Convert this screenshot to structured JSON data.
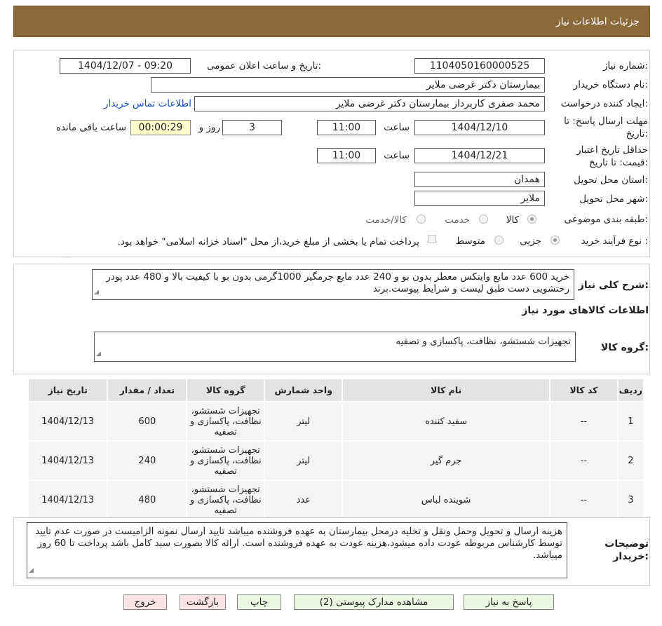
{
  "header": {
    "title": "جزئیات اطلاعات نیاز"
  },
  "watermark": {
    "text": "AriaTender.neT"
  },
  "form": {
    "need_number_label": "شماره نیاز:",
    "need_number": "1104050160000525",
    "announce_label": "تاریخ و ساعت اعلان عمومی:",
    "announce_value": "1404/12/07 - 09:20",
    "buyer_org_label": "نام دستگاه خریدار:",
    "buyer_org": "بیمارستان دکتر غرضی ملایر",
    "creator_label": "ایجاد کننده درخواست:",
    "creator": "محمد صفری کارپرداز بیمارستان دکتر غرضی ملایر",
    "contact_link": "اطلاعات تماس خریدار",
    "deadline_label_1": "مهلت ارسال پاسخ: تا",
    "deadline_label_2": "تاریخ:",
    "deadline_date": "1404/12/10",
    "time_label": "ساعت",
    "deadline_time": "11:00",
    "days_value": "3",
    "days_label": "روز و",
    "timer_value": "00:00:29",
    "remaining_label": "ساعت باقی مانده",
    "validity_label_1": "حداقل تاریخ اعتبار",
    "validity_label_2": "قیمت: تا تاریخ:",
    "validity_date": "1404/12/21",
    "validity_time": "11:00",
    "province_label": "استان محل تحویل:",
    "province": "همدان",
    "city_label": "شهر محل تحویل:",
    "city": "ملایر",
    "category_label": "طبقه بندی موضوعی:",
    "category_options": [
      "کالا",
      "خدمت",
      "کالا/خدمت"
    ],
    "process_label": "نوع فرآیند خرید :",
    "process_options": [
      "جزیی",
      "متوسط"
    ],
    "payment_note": "پرداخت تمام یا بخشی از مبلغ خرید،از محل \"اسناد خزانه اسلامی\" خواهد بود."
  },
  "summary": {
    "label": "شرح کلی نیاز:",
    "text": "خرید 600  عدد مایع وایتکس معطر بدون بو و 240 عدد مایع جرمگیر 1000گرمی بدون بو با کیفیت بالا و 480 عدد پودر  رختشویی دست طبق لیست و شرایط پیوست.برند",
    "goods_info_title": "اطلاعات کالاهای مورد نیاز",
    "group_label": "گروه کالا:",
    "group_value": "تجهیزات شستشو، نظافت، پاکسازی و تصفیه"
  },
  "table": {
    "headers": [
      "ردیف",
      "کد کالا",
      "نام کالا",
      "واحد شمارش",
      "گروه کالا",
      "تعداد / مقدار",
      "تاریخ نیاز"
    ],
    "rows": [
      {
        "row": "1",
        "code": "--",
        "name": "سفید کننده",
        "unit": "لیتر",
        "group": "تجهیزات شستشو، نظافت، پاکسازی و تصفیه",
        "qty": "600",
        "date": "1404/12/13"
      },
      {
        "row": "2",
        "code": "--",
        "name": "جرم گیر",
        "unit": "لیتر",
        "group": "تجهیزات شستشو، نظافت، پاکسازی و تصفیه",
        "qty": "240",
        "date": "1404/12/13"
      },
      {
        "row": "3",
        "code": "--",
        "name": "شوینده لباس",
        "unit": "عدد",
        "group": "تجهیزات شستشو، نظافت، پاکسازی و تصفیه",
        "qty": "480",
        "date": "1404/12/13"
      }
    ]
  },
  "notes": {
    "label_1": "توضیحات",
    "label_2": "خریدار:",
    "text": "هزینه ارسال و تحویل وحمل ونقل و تخلیه درمحل بیمارستان به عهده فروشنده میباشد تایید ارسال نمونه الزامیست در صورت عدم تایید توسط کارشناس مربوطه عودت داده میشود،هزینه عودت به عهده فروشنده است. ارائه کالا  بصورت سبد کامل باشد پرداخت تا 60 روز میباشد."
  },
  "buttons": {
    "reply": "پاسخ به نیاز",
    "attachments": "مشاهده مدارک پیوستی (2)",
    "print": "چاپ",
    "back": "بازگشت",
    "exit": "خروج"
  }
}
